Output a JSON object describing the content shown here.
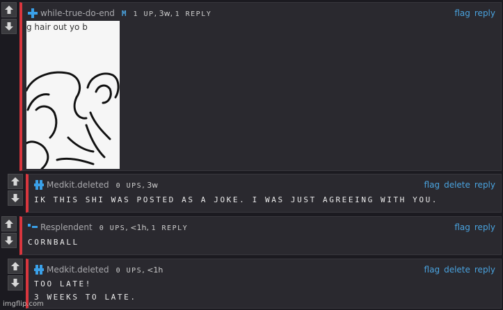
{
  "comments": [
    {
      "username": "while-true-do-end",
      "badge": "M",
      "ups": "1 up",
      "age": "3w",
      "replies": "1 reply",
      "actions": [
        "flag",
        "reply"
      ],
      "image_caption": "g hair out yo b"
    },
    {
      "username": "Medkit.deleted",
      "ups": "0 ups",
      "age": "3w",
      "actions": [
        "flag",
        "delete",
        "reply"
      ],
      "text_lines": [
        "Ik this shi was posted as a joke. I was just agreeing with you."
      ]
    },
    {
      "username": "Resplendent",
      "ups": "0 ups",
      "age": "<1h",
      "replies": "1 reply",
      "actions": [
        "flag",
        "reply"
      ],
      "text_lines": [
        "Cornball"
      ]
    },
    {
      "username": "Medkit.deleted",
      "ups": "0 ups",
      "age": "<1h",
      "actions": [
        "flag",
        "delete",
        "reply"
      ],
      "text_lines": [
        "Too late!",
        "3 weeks to late."
      ]
    }
  ],
  "watermark": "imgflip.com",
  "colors": {
    "accent_border": "#d9363e",
    "link": "#4aa3df",
    "panel": "#2a292f",
    "page": "#1b1a20"
  }
}
